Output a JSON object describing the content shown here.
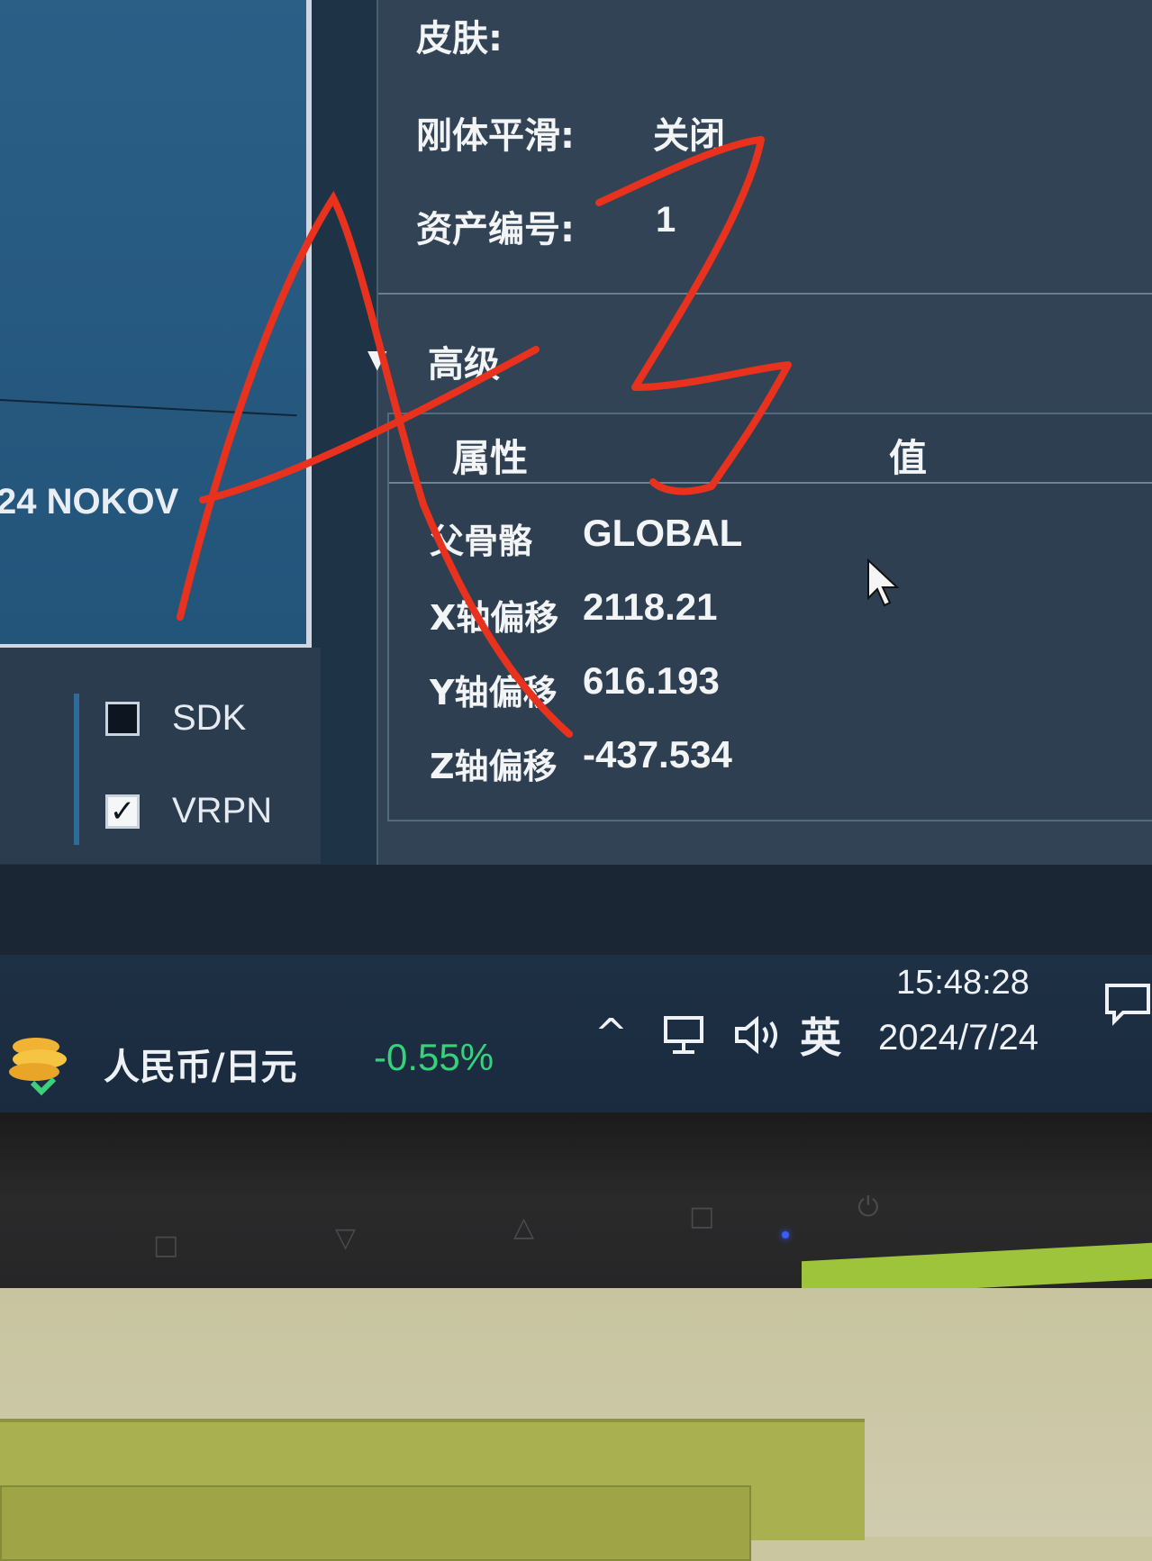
{
  "left_panel": {
    "partial_label": "24 NOKOV",
    "checkboxes": [
      {
        "label": "SDK",
        "checked": false
      },
      {
        "label": "VRPN",
        "checked": true
      }
    ]
  },
  "properties": {
    "skin_label": "皮肤:",
    "smoothing_label": "刚体平滑:",
    "smoothing_value": "关闭",
    "asset_id_label": "资产编号:",
    "asset_id_value": "1"
  },
  "advanced": {
    "title": "高级",
    "table": {
      "col_property": "属性",
      "col_value": "值",
      "rows": [
        {
          "label": "父骨骼",
          "value": "GLOBAL"
        },
        {
          "label": "X轴偏移",
          "value": "2118.21"
        },
        {
          "label": "Y轴偏移",
          "value": "616.193"
        },
        {
          "label": "Z轴偏移",
          "value": "-437.534"
        }
      ]
    }
  },
  "handwriting": "A3",
  "taskbar": {
    "currency_pair": "人民币/日元",
    "currency_change": "-0.55%",
    "ime": "英",
    "time": "15:48:28",
    "date": "2024/7/24"
  },
  "colors": {
    "annotation": "#e8321e",
    "change_negative": "#35d27a",
    "panel_blue": "#2b5f86"
  }
}
